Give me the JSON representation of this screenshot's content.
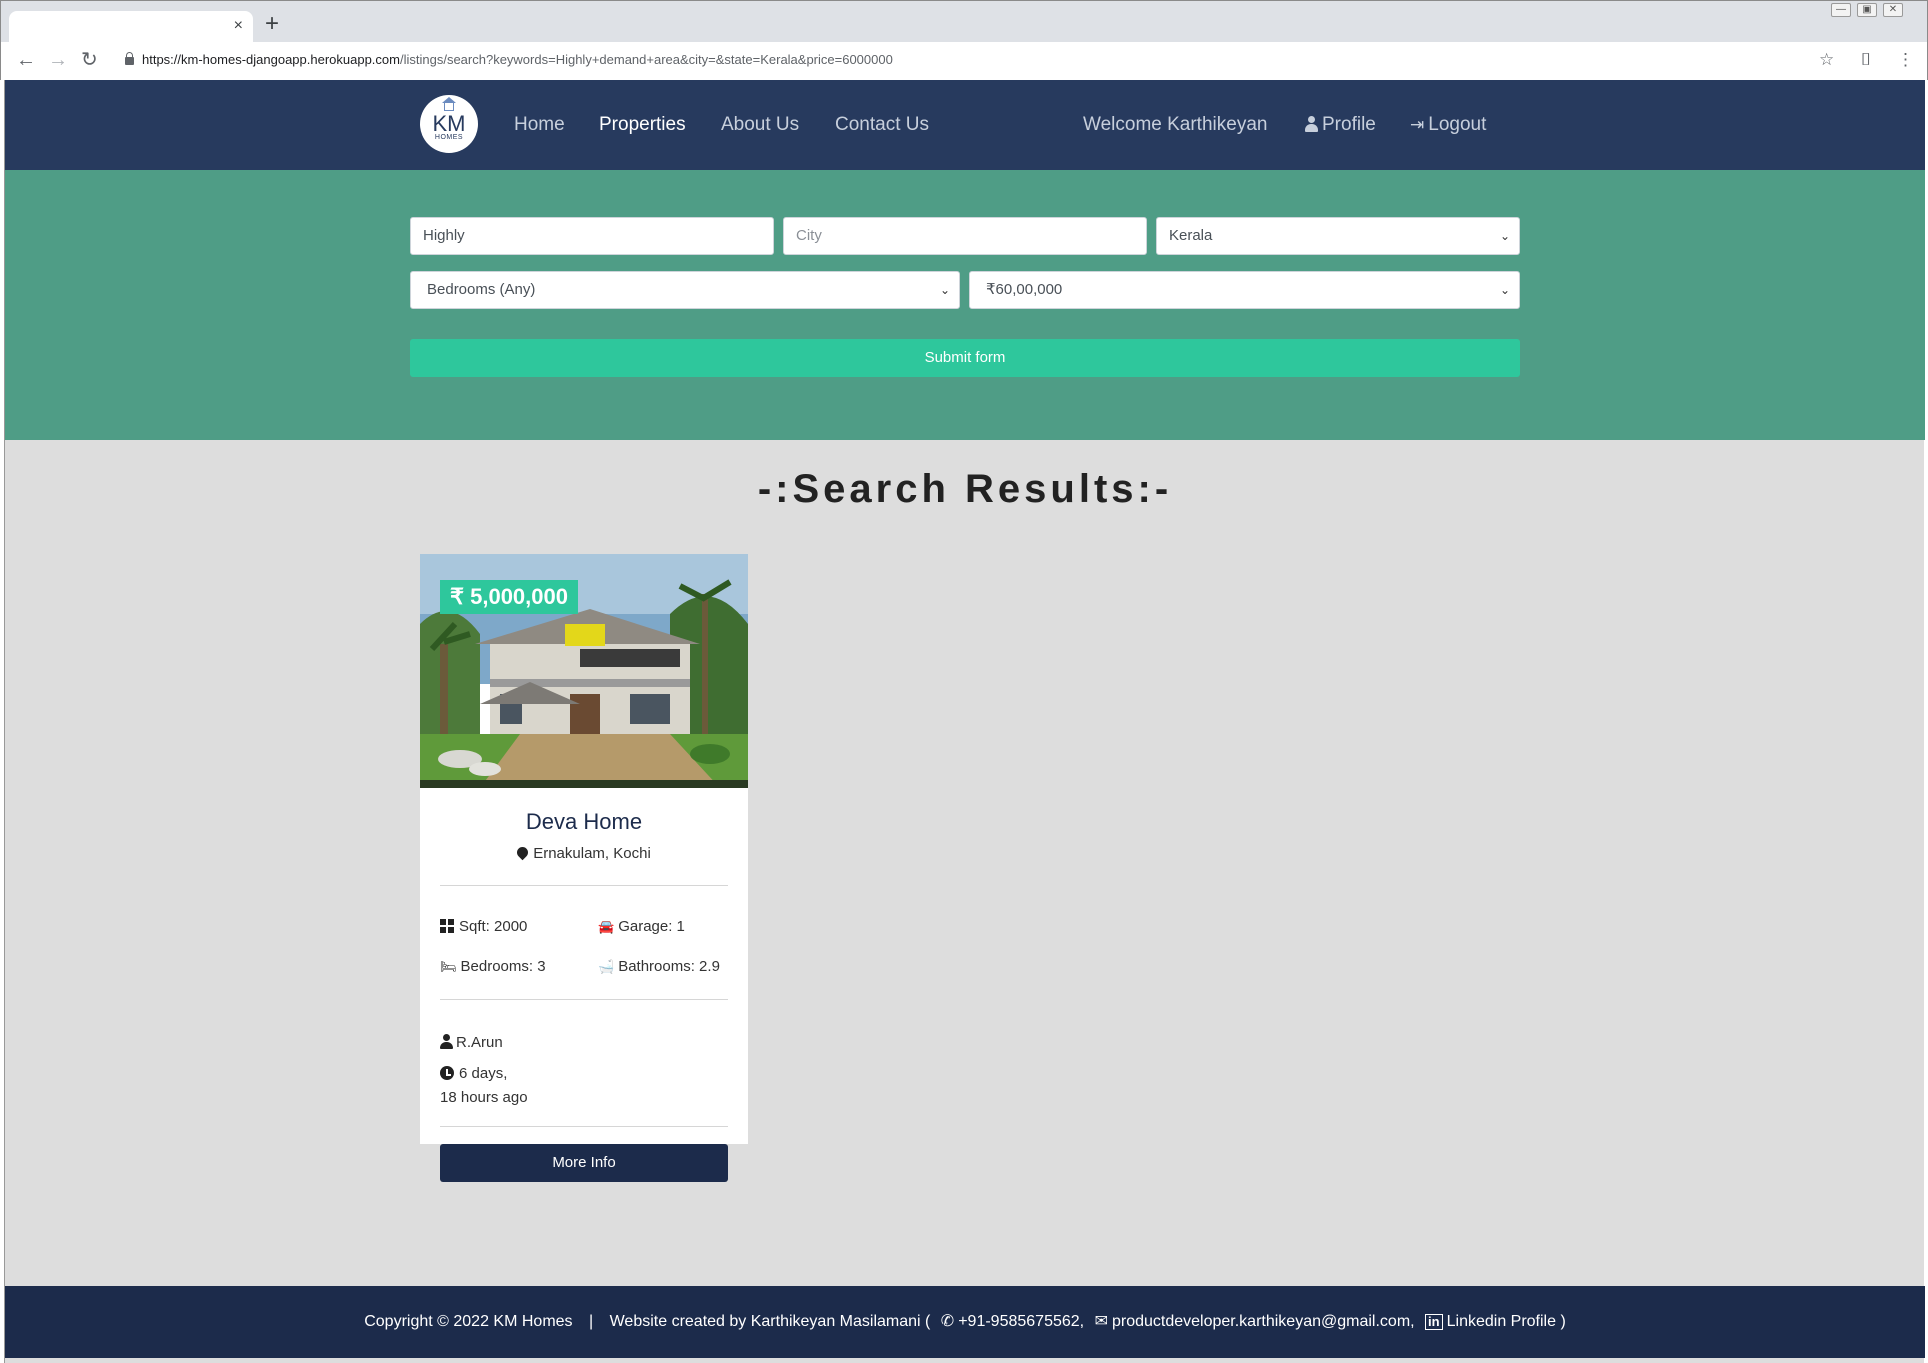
{
  "browser": {
    "tab_close": "×",
    "new_tab": "+",
    "url_host": "https://km-homes-djangoapp.herokuapp.com",
    "url_path": "/listings/search?keywords=Highly+demand+area&city=&state=Kerala&price=6000000"
  },
  "navbar": {
    "logo_text": "KM",
    "logo_sub": "HOMES",
    "links": [
      "Home",
      "Properties",
      "About Us",
      "Contact Us"
    ],
    "active_link": "Properties",
    "welcome": "Welcome Karthikeyan",
    "profile": "Profile",
    "logout": "Logout"
  },
  "search": {
    "keywords_value": "Highly",
    "city_placeholder": "City",
    "state_value": "Kerala",
    "bedrooms_value": "Bedrooms (Any)",
    "price_value": "₹60,00,000",
    "submit_label": "Submit form"
  },
  "results": {
    "title": "-:Search Results:-",
    "listings": [
      {
        "price": "₹ 5,000,000",
        "title": "Deva Home",
        "location": "Ernakulam, Kochi",
        "sqft": "Sqft: 2000",
        "garage": "Garage: 1",
        "bedrooms": "Bedrooms: 3",
        "bathrooms": "Bathrooms: 2.9",
        "realtor": "R.Arun",
        "time_line1": "6 days,",
        "time_line2": "18 hours ago",
        "button": "More Info"
      }
    ]
  },
  "footer": {
    "copyright": "Copyright © 2022 KM Homes",
    "separator": "|",
    "created_by": "Website created by Karthikeyan Masilamani (",
    "phone": "+91-9585675562,",
    "email": "productdeveloper.karthikeyan@gmail.com,",
    "linkedin": "Linkedin Profile )"
  },
  "colors": {
    "navbar_bg": "#273a5e",
    "search_band_bg": "#4f9d86",
    "accent_green": "#2ec79c",
    "footer_bg": "#1c2b4b",
    "page_bg": "#dddddd"
  }
}
